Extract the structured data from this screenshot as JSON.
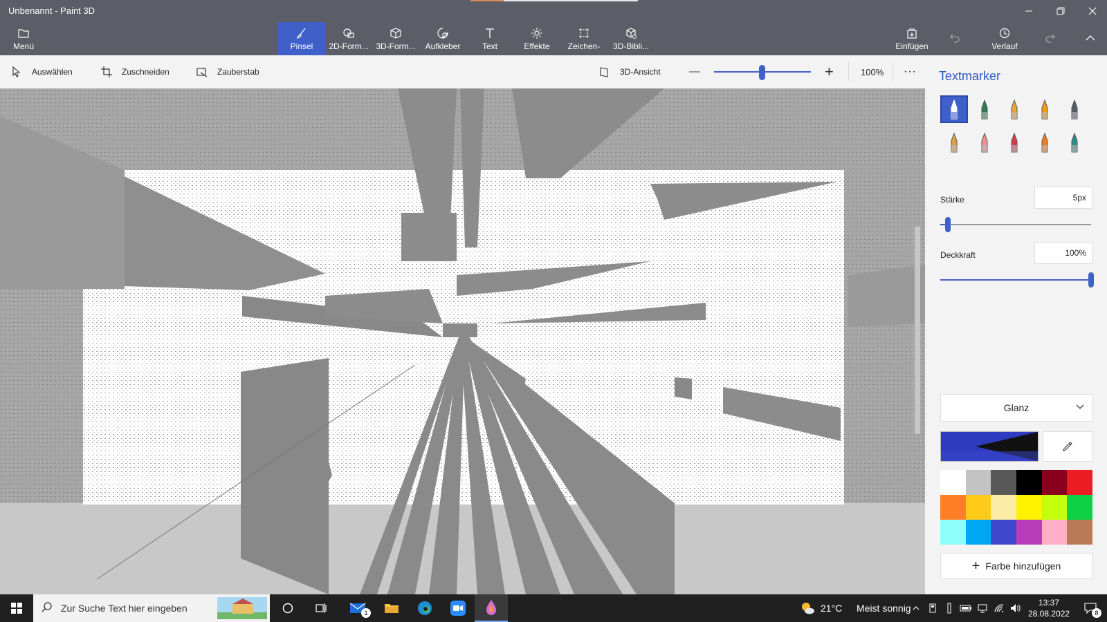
{
  "window": {
    "title": "Unbenannt - Paint 3D",
    "minimize_icon": "minimize-icon",
    "restore_icon": "restore-icon",
    "close_icon": "close-icon"
  },
  "ribbon": {
    "menu_label": "Menü",
    "tools": [
      {
        "label": "Pinsel",
        "icon": "brush-icon",
        "active": true
      },
      {
        "label": "2D-Form...",
        "icon": "2d-shapes-icon"
      },
      {
        "label": "3D-Form...",
        "icon": "3d-shapes-icon"
      },
      {
        "label": "Aufkleber",
        "icon": "sticker-icon"
      },
      {
        "label": "Text",
        "icon": "text-icon"
      },
      {
        "label": "Effekte",
        "icon": "effects-icon"
      },
      {
        "label": "Zeichen-",
        "icon": "canvas-icon"
      },
      {
        "label": "3D-Bibli...",
        "icon": "3d-library-icon"
      }
    ],
    "insert_label": "Einfügen",
    "history_label": "Verlauf"
  },
  "toolbar": {
    "select_label": "Auswählen",
    "crop_label": "Zuschneiden",
    "magic_label": "Zauberstab",
    "view3d_label": "3D-Ansicht",
    "zoom_minus": "—",
    "zoom_plus": "+",
    "zoom_value": "100%",
    "more": "···"
  },
  "panel": {
    "title": "Textmarker",
    "brushes": [
      {
        "name": "marker-icon",
        "color": "#ffffff",
        "selected": true
      },
      {
        "name": "calligraphy-pen-icon",
        "color": "#2a7d4f"
      },
      {
        "name": "oil-brush-icon",
        "color": "#e8a33a"
      },
      {
        "name": "watercolor-icon",
        "color": "#f39c12"
      },
      {
        "name": "pixel-pen-icon",
        "color": "#555a66"
      },
      {
        "name": "pencil-icon",
        "color": "#d9a441"
      },
      {
        "name": "eraser-icon",
        "color": "#ef8f8f"
      },
      {
        "name": "crayon-icon",
        "color": "#d83a4a"
      },
      {
        "name": "spray-can-icon",
        "color": "#f07c1a"
      },
      {
        "name": "fill-icon",
        "color": "#2e8b8b"
      }
    ],
    "thickness_label": "Stärke",
    "thickness_value": "5px",
    "thickness_fraction": 0.05,
    "opacity_label": "Deckkraft",
    "opacity_value": "100%",
    "opacity_fraction": 1.0,
    "finish_value": "Glanz",
    "current_color": "#2f3bbf",
    "palette": [
      [
        "#ffffff",
        "#c3c3c3",
        "#585858",
        "#000000",
        "#88001b",
        "#ec1c24"
      ],
      [
        "#ff7f27",
        "#ffca18",
        "#fdeca6",
        "#fff200",
        "#c4ff0e",
        "#0ed145"
      ],
      [
        "#8cfffb",
        "#00a8f3",
        "#3f48cc",
        "#b83dba",
        "#ffaec8",
        "#b97a56"
      ]
    ],
    "add_color_label": "Farbe hinzufügen"
  },
  "taskbar": {
    "search_placeholder": "Zur Suche Text hier eingeben",
    "weather_temp": "21°C",
    "weather_text": "Meist sonnig",
    "time": "13:37",
    "date": "28.08.2022",
    "mail_badge": "1",
    "notification_badge": "8"
  }
}
